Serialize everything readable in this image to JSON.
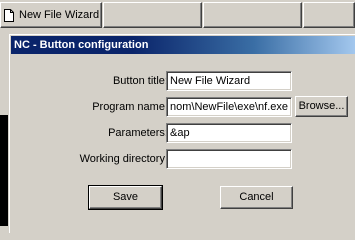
{
  "toolbar": {
    "active_button_label": "New File Wizard"
  },
  "dialog": {
    "title": "NC - Button configuration",
    "fields": {
      "button_title_label": "Button title:",
      "button_title_value": "New File Wizard",
      "program_name_label": "Program name:",
      "program_name_value": "nom\\NewFile\\exe\\nf.exe",
      "parameters_label": "Parameters:",
      "parameters_value": "&ap",
      "working_directory_label": "Working directory:",
      "working_directory_value": ""
    },
    "browse_label": "Browse...",
    "save_label": "Save",
    "cancel_label": "Cancel"
  }
}
